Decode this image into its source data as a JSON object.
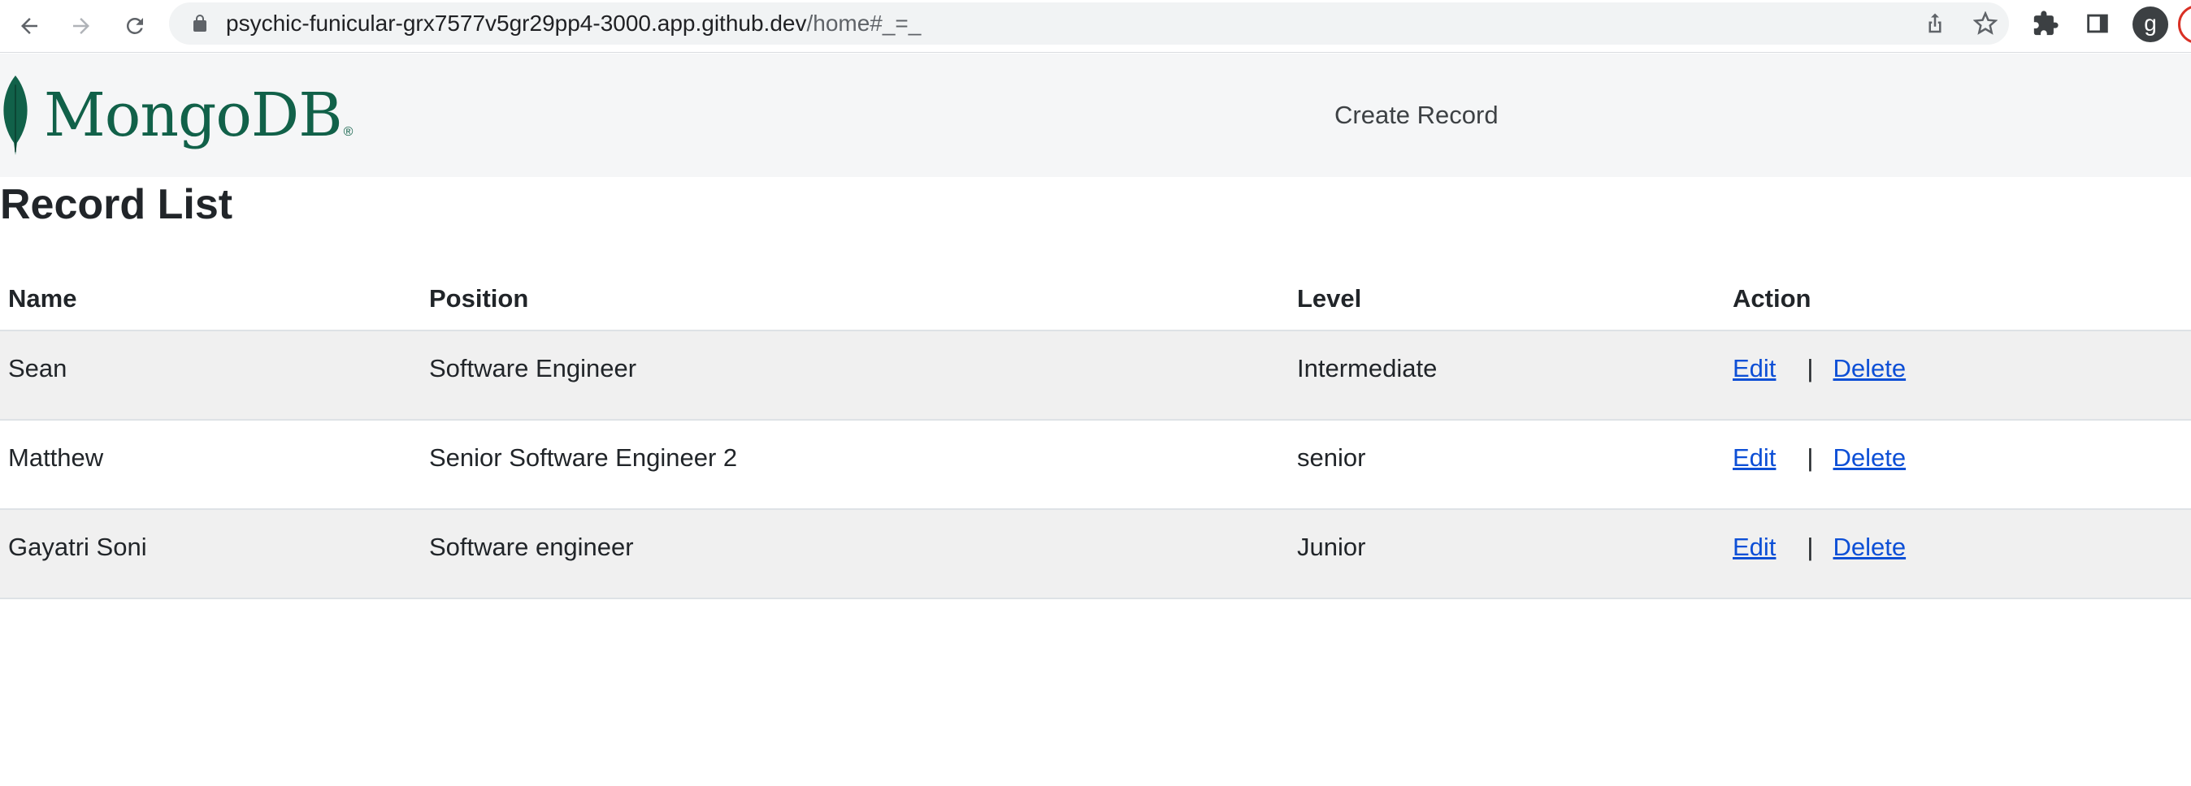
{
  "browser": {
    "url_host": "psychic-funicular-grx7577v5gr29pp4-3000.app.github.dev",
    "url_path": "/home#_=_",
    "profile_initial": "g",
    "icons": [
      "back-icon",
      "forward-icon",
      "reload-icon",
      "lock-icon",
      "share-icon",
      "star-icon",
      "extensions-icon",
      "side-panel-icon"
    ]
  },
  "navbar": {
    "logo_text": "MongoDB",
    "logo_reg": "®",
    "create_record_label": "Create Record",
    "brand_color": "#116149"
  },
  "main": {
    "title": "Record List",
    "table": {
      "headers": [
        "Name",
        "Position",
        "Level",
        "Action"
      ],
      "rows": [
        {
          "name": "Sean",
          "position": "Software Engineer",
          "level": "Intermediate",
          "edit": "Edit",
          "sep": "|",
          "delete": "Delete"
        },
        {
          "name": "Matthew",
          "position": "Senior Software Engineer 2",
          "level": "senior",
          "edit": "Edit",
          "sep": "|",
          "delete": "Delete"
        },
        {
          "name": "Gayatri Soni",
          "position": "Software engineer",
          "level": "Junior",
          "edit": "Edit",
          "sep": "|",
          "delete": "Delete"
        }
      ]
    },
    "link_color": "#0d4fd6"
  }
}
